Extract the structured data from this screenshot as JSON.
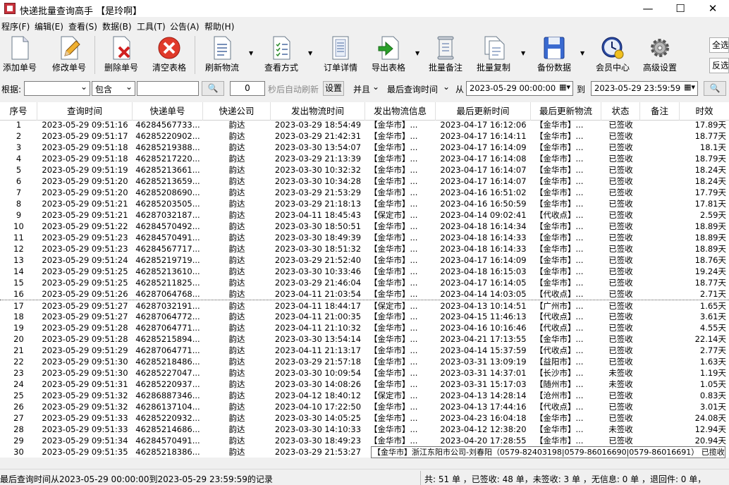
{
  "window": {
    "title": "快递批量查询高手 【是玲啊】",
    "minimize": "—",
    "maximize": "☐",
    "close": "✕"
  },
  "menu": [
    "程序(F)",
    "编辑(E)",
    "查看(S)",
    "数据(B)",
    "工具(T)",
    "公告(A)",
    "帮助(H)"
  ],
  "toolbar": {
    "add": "添加单号",
    "edit": "修改单号",
    "delete": "删除单号",
    "clear": "清空表格",
    "refresh": "刷新物流",
    "view_mode": "查看方式",
    "order_detail": "订单详情",
    "export": "导出表格",
    "batch_note": "批量备注",
    "batch_copy": "批量复制",
    "backup": "备份数据",
    "member": "会员中心",
    "advanced": "高级设置",
    "select_all": "全选",
    "invert": "反选"
  },
  "filter": {
    "basis_label": "根据:",
    "basis_value": "",
    "match_value": "包含",
    "keyword": "",
    "seconds_value": "0",
    "auto_refresh_label": "秒后自动刷新",
    "set_button": "设置",
    "logic_value": "并且",
    "field_value": "最后查询时间",
    "from_label": "从",
    "from_value": "2023-05-29 00:00:00",
    "to_label": "到",
    "to_value": "2023-05-29 23:59:59"
  },
  "columns": [
    "序号",
    "查询时间",
    "快递单号",
    "快递公司",
    "发出物流时间",
    "发出物流信息",
    "最后更新时间",
    "最后更新物流",
    "状态",
    "备注",
    "时效"
  ],
  "rows": [
    [
      "1",
      "2023-05-29 09:51:16",
      "46284567733...",
      "韵达",
      "2023-03-29 18:54:49",
      "【金华市】...",
      "2023-04-17 16:12:06",
      "【金华市】...",
      "已签收",
      "",
      "17.89天"
    ],
    [
      "2",
      "2023-05-29 09:51:17",
      "46285220902...",
      "韵达",
      "2023-03-29 21:42:31",
      "【金华市】...",
      "2023-04-17 16:14:11",
      "【金华市】...",
      "已签收",
      "",
      "18.77天"
    ],
    [
      "3",
      "2023-05-29 09:51:18",
      "46285219388...",
      "韵达",
      "2023-03-30 13:54:07",
      "【金华市】...",
      "2023-04-17 16:14:09",
      "【金华市】...",
      "已签收",
      "",
      "18.1天"
    ],
    [
      "4",
      "2023-05-29 09:51:18",
      "46285217220...",
      "韵达",
      "2023-03-29 21:13:39",
      "【金华市】...",
      "2023-04-17 16:14:08",
      "【金华市】...",
      "已签收",
      "",
      "18.79天"
    ],
    [
      "5",
      "2023-05-29 09:51:19",
      "46285213661...",
      "韵达",
      "2023-03-30 10:32:32",
      "【金华市】...",
      "2023-04-17 16:14:07",
      "【金华市】...",
      "已签收",
      "",
      "18.24天"
    ],
    [
      "6",
      "2023-05-29 09:51:20",
      "46285213659...",
      "韵达",
      "2023-03-30 10:34:28",
      "【金华市】...",
      "2023-04-17 16:14:07",
      "【金华市】...",
      "已签收",
      "",
      "18.24天"
    ],
    [
      "7",
      "2023-05-29 09:51:20",
      "46285208690...",
      "韵达",
      "2023-03-29 21:53:29",
      "【金华市】...",
      "2023-04-16 16:51:02",
      "【金华市】...",
      "已签收",
      "",
      "17.79天"
    ],
    [
      "8",
      "2023-05-29 09:51:21",
      "46285203505...",
      "韵达",
      "2023-03-29 21:18:13",
      "【金华市】...",
      "2023-04-16 16:50:59",
      "【金华市】...",
      "已签收",
      "",
      "17.81天"
    ],
    [
      "9",
      "2023-05-29 09:51:21",
      "46287032187...",
      "韵达",
      "2023-04-11 18:45:43",
      "【保定市】...",
      "2023-04-14 09:02:41",
      "【代收点】...",
      "已签收",
      "",
      "2.59天"
    ],
    [
      "10",
      "2023-05-29 09:51:22",
      "46284570492...",
      "韵达",
      "2023-03-30 18:50:51",
      "【金华市】...",
      "2023-04-18 16:14:34",
      "【金华市】...",
      "已签收",
      "",
      "18.89天"
    ],
    [
      "11",
      "2023-05-29 09:51:23",
      "46284570491...",
      "韵达",
      "2023-03-30 18:49:39",
      "【金华市】...",
      "2023-04-18 16:14:33",
      "【金华市】...",
      "已签收",
      "",
      "18.89天"
    ],
    [
      "12",
      "2023-05-29 09:51:23",
      "46284567717...",
      "韵达",
      "2023-03-30 18:51:32",
      "【金华市】...",
      "2023-04-18 16:14:33",
      "【金华市】...",
      "已签收",
      "",
      "18.89天"
    ],
    [
      "13",
      "2023-05-29 09:51:24",
      "46285219719...",
      "韵达",
      "2023-03-29 21:52:40",
      "【金华市】...",
      "2023-04-17 16:14:09",
      "【金华市】...",
      "已签收",
      "",
      "18.76天"
    ],
    [
      "14",
      "2023-05-29 09:51:25",
      "46285213610...",
      "韵达",
      "2023-03-30 10:33:46",
      "【金华市】...",
      "2023-04-18 16:15:03",
      "【金华市】...",
      "已签收",
      "",
      "19.24天"
    ],
    [
      "15",
      "2023-05-29 09:51:25",
      "46285211825...",
      "韵达",
      "2023-03-29 21:46:04",
      "【金华市】...",
      "2023-04-17 16:14:05",
      "【金华市】...",
      "已签收",
      "",
      "18.77天"
    ],
    [
      "16",
      "2023-05-29 09:51:26",
      "46287064768...",
      "韵达",
      "2023-04-11 21:03:54",
      "【金华市】...",
      "2023-04-14 14:03:05",
      "【代收点】...",
      "已签收",
      "",
      "2.71天"
    ],
    [
      "17",
      "2023-05-29 09:51:27",
      "46287032191...",
      "韵达",
      "2023-04-11 18:44:17",
      "【保定市】...",
      "2023-04-13 10:14:51",
      "【广州市】...",
      "已签收",
      "",
      "1.65天"
    ],
    [
      "18",
      "2023-05-29 09:51:27",
      "46287064772...",
      "韵达",
      "2023-04-11 21:00:35",
      "【金华市】...",
      "2023-04-15 11:46:13",
      "【代收点】...",
      "已签收",
      "",
      "3.61天"
    ],
    [
      "19",
      "2023-05-29 09:51:28",
      "46287064771...",
      "韵达",
      "2023-04-11 21:10:32",
      "【金华市】...",
      "2023-04-16 10:16:46",
      "【代收点】...",
      "已签收",
      "",
      "4.55天"
    ],
    [
      "20",
      "2023-05-29 09:51:28",
      "46285215894...",
      "韵达",
      "2023-03-30 13:54:14",
      "【金华市】...",
      "2023-04-21 17:13:55",
      "【金华市】...",
      "已签收",
      "",
      "22.14天"
    ],
    [
      "21",
      "2023-05-29 09:51:29",
      "46287064771...",
      "韵达",
      "2023-04-11 21:13:17",
      "【金华市】...",
      "2023-04-14 15:37:59",
      "【代收点】...",
      "已签收",
      "",
      "2.77天"
    ],
    [
      "22",
      "2023-05-29 09:51:30",
      "46285218486...",
      "韵达",
      "2023-03-29 21:57:18",
      "【金华市】...",
      "2023-03-31 13:09:19",
      "【益阳市】...",
      "已签收",
      "",
      "1.63天"
    ],
    [
      "23",
      "2023-05-29 09:51:30",
      "46285227047...",
      "韵达",
      "2023-03-30 10:09:54",
      "【金华市】...",
      "2023-03-31 14:37:01",
      "【长沙市】...",
      "未签收",
      "",
      "1.19天"
    ],
    [
      "24",
      "2023-05-29 09:51:31",
      "46285220937...",
      "韵达",
      "2023-03-30 14:08:26",
      "【金华市】...",
      "2023-03-31 15:17:03",
      "【随州市】...",
      "未签收",
      "",
      "1.05天"
    ],
    [
      "25",
      "2023-05-29 09:51:32",
      "46286887346...",
      "韵达",
      "2023-04-12 18:40:12",
      "【保定市】...",
      "2023-04-13 14:28:14",
      "【沧州市】...",
      "已签收",
      "",
      "0.83天"
    ],
    [
      "26",
      "2023-05-29 09:51:32",
      "46286137104...",
      "韵达",
      "2023-04-10 17:22:50",
      "【金华市】...",
      "2023-04-13 17:44:16",
      "【代收点】...",
      "已签收",
      "",
      "3.01天"
    ],
    [
      "27",
      "2023-05-29 09:51:33",
      "46285220932...",
      "韵达",
      "2023-03-30 14:05:25",
      "【金华市】...",
      "2023-04-23 16:04:18",
      "【金华市】...",
      "已签收",
      "",
      "24.08天"
    ],
    [
      "28",
      "2023-05-29 09:51:33",
      "46285214686...",
      "韵达",
      "2023-03-30 14:10:33",
      "【金华市】...",
      "2023-04-12 12:38:20",
      "【金华市】...",
      "未签收",
      "",
      "12.94天"
    ],
    [
      "29",
      "2023-05-29 09:51:34",
      "46284570491...",
      "韵达",
      "2023-03-30 18:49:23",
      "【金华市】...",
      "2023-04-20 17:28:55",
      "【金华市】...",
      "已签收",
      "",
      "20.94天"
    ],
    [
      "30",
      "2023-05-29 09:51:35",
      "46285218386...",
      "韵达",
      "2023-03-29 21:53:27",
      "【金华市】...",
      "",
      "",
      "",
      "",
      ""
    ]
  ],
  "tooltip": "【金华市】浙江东阳市公司-刘春阳（0579-82403198|0579-86016690|0579-86016691） 已揽收",
  "status": {
    "left": "最后查询时间从2023-05-29 00:00:00到2023-05-29 23:59:59的记录",
    "right": "共: 51 单 ，已签收: 48 单，未签收: 3 单 ，无信息: 0 单 ，退回件: 0 单，"
  }
}
